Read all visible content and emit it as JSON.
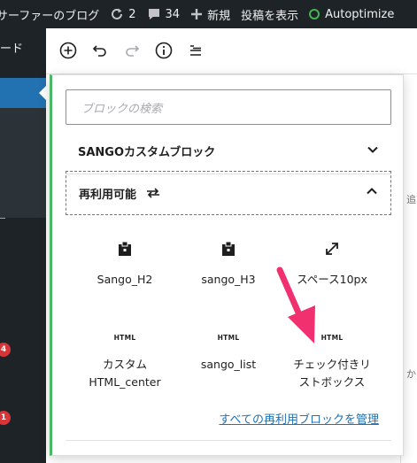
{
  "admin_bar": {
    "site_title": "サーファーのブログ",
    "updates_count": "2",
    "comments_count": "34",
    "new_label": "新規",
    "view_post_label": "投稿を表示",
    "plugin_label": "Autoptimize"
  },
  "sidebar": {
    "dashboard_fragment": "ード",
    "badges": [
      "4",
      "1"
    ]
  },
  "toolbar": {
    "icons": [
      "add-block-icon",
      "undo-icon",
      "redo-icon",
      "info-icon",
      "list-view-icon"
    ]
  },
  "background": {
    "side_text_1": "追",
    "side_text_2": "か"
  },
  "inserter": {
    "search_placeholder": "ブロックの検索",
    "panels": [
      {
        "label": "SANGOカスタムブロック",
        "expanded": false
      },
      {
        "label": "再利用可能",
        "expanded": true
      }
    ],
    "blocks": [
      {
        "label": "Sango_H2",
        "icon": "reusable-block-icon"
      },
      {
        "label": "sango_H3",
        "icon": "reusable-block-icon"
      },
      {
        "label": "スペース10px",
        "icon": "resize-icon"
      },
      {
        "label_line1": "カスタム",
        "label_line2": "HTML_center",
        "icon": "html-icon",
        "icon_text": "HTML"
      },
      {
        "label": "sango_list",
        "icon": "html-icon",
        "icon_text": "HTML"
      },
      {
        "label_line1": "チェック付きリ",
        "label_line2": "ストボックス",
        "icon": "html-icon",
        "icon_text": "HTML"
      }
    ],
    "manage_link": "すべての再利用ブロックを管理"
  },
  "colors": {
    "admin_bar_bg": "#1d2327",
    "accent_blue": "#2271b1",
    "annotation_arrow": "#f0306f",
    "green_indicator": "#4ab866"
  }
}
